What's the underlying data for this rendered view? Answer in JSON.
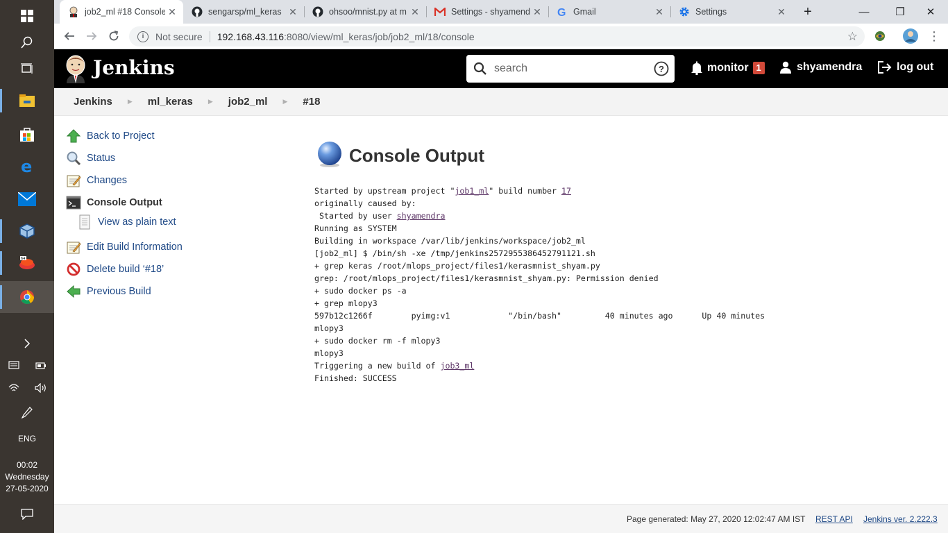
{
  "browser": {
    "tabs": [
      {
        "title": "job2_ml #18 Console",
        "active": true,
        "favicon": "jenkins-icon"
      },
      {
        "title": "sengarsp/ml_keras",
        "active": false,
        "favicon": "github-icon"
      },
      {
        "title": "ohsoo/mnist.py at m",
        "active": false,
        "favicon": "github-icon"
      },
      {
        "title": "Settings - shyamendr",
        "active": false,
        "favicon": "gmail-icon"
      },
      {
        "title": "Gmail",
        "active": false,
        "favicon": "google-icon"
      },
      {
        "title": "Settings",
        "active": false,
        "favicon": "settings-icon"
      }
    ],
    "security": "Not secure",
    "url_host": "192.168.43.116",
    "url_rest": ":8080/view/ml_keras/job/job2_ml/18/console"
  },
  "taskbar": {
    "language": "ENG",
    "time": "00:02",
    "day": "Wednesday",
    "date": "27-05-2020"
  },
  "header": {
    "title": "Jenkins",
    "search_placeholder": "search",
    "monitor_label": "monitor",
    "monitor_count": "1",
    "user": "shyamendra",
    "logout": "log out"
  },
  "breadcrumb": [
    "Jenkins",
    "ml_keras",
    "job2_ml",
    "#18"
  ],
  "side": {
    "back": "Back to Project",
    "status": "Status",
    "changes": "Changes",
    "console": "Console Output",
    "plain": "View as plain text",
    "edit": "Edit Build Information",
    "delete": "Delete build ‘#18’",
    "previous": "Previous Build"
  },
  "main": {
    "title": "Console Output",
    "lines": [
      {
        "pre": "Started by upstream project \"",
        "link": "job1_ml",
        "post": "\" build number ",
        "link2": "17"
      },
      {
        "pre": "originally caused by:"
      },
      {
        "pre": " Started by user ",
        "link": "shyamendra"
      },
      {
        "pre": "Running as SYSTEM"
      },
      {
        "pre": "Building in workspace /var/lib/jenkins/workspace/job2_ml"
      },
      {
        "pre": "[job2_ml] $ /bin/sh -xe /tmp/jenkins2572955386452791121.sh"
      },
      {
        "pre": "+ grep keras /root/mlops_project/files1/kerasmnist_shyam.py"
      },
      {
        "pre": "grep: /root/mlops_project/files1/kerasmnist_shyam.py: Permission denied"
      },
      {
        "pre": "+ sudo docker ps -a"
      },
      {
        "pre": "+ grep mlopy3"
      },
      {
        "pre": "597b12c1266f        pyimg:v1            \"/bin/bash\"         40 minutes ago      Up 40 minutes"
      },
      {
        "pre": "mlopy3"
      },
      {
        "pre": "+ sudo docker rm -f mlopy3"
      },
      {
        "pre": "mlopy3"
      },
      {
        "pre": "Triggering a new build of ",
        "link": "job3_ml"
      },
      {
        "pre": "Finished: SUCCESS"
      }
    ]
  },
  "footer": {
    "generated": "Page generated: May 27, 2020 12:02:47 AM IST",
    "rest_api": "REST API",
    "version": "Jenkins ver. 2.222.3"
  }
}
